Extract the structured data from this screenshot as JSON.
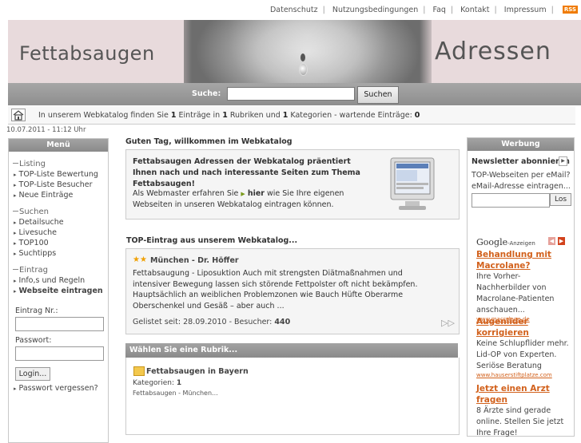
{
  "top_links": [
    "Datenschutz",
    "Nutzungsbedingungen",
    "Faq",
    "Kontakt",
    "Impressum"
  ],
  "rss_label": "RSS",
  "header": {
    "left_title": "Fettabsaugen",
    "right_title": "Adressen"
  },
  "search": {
    "label": "Suche:",
    "value": "",
    "button": "Suchen"
  },
  "infobar": {
    "t1": "In unserem Webkatalog finden Sie ",
    "eintraege": "1",
    "t2": " Einträge in ",
    "rubriken": "1",
    "t3": " Rubriken und ",
    "kategorien": "1",
    "t4": " Kategorien - wartende Einträge: ",
    "wartend": "0"
  },
  "datetime": "10.07.2011 - 11:12 Uhr",
  "menu": {
    "header": "Menü",
    "groups": [
      {
        "label": "Listing",
        "items": [
          "TOP-Liste Bewertung",
          "TOP-Liste Besucher",
          "Neue Einträge"
        ]
      },
      {
        "label": "Suchen",
        "items": [
          "Detailsuche",
          "Livesuche",
          "TOP100",
          "Suchtipps"
        ]
      },
      {
        "label": "Eintrag",
        "items": [
          "Info,s und Regeln",
          "Webseite eintragen"
        ]
      }
    ],
    "login": {
      "nr_label": "Eintrag Nr.:",
      "pw_label": "Passwort:",
      "button": "Login...",
      "forgot": "Passwort vergessen?"
    }
  },
  "main": {
    "greeting": "Guten Tag, willkommen im Webkatalog",
    "intro_bold": "Fettabsaugen Adressen der Webkatalog präentiert Ihnen nach und nach interessante Seiten zum Thema Fettabsaugen!",
    "intro_text_1": "Als Webmaster erfahren Sie ",
    "intro_link": "hier",
    "intro_text_2": " wie Sie Ihre eigenen Webseiten in unseren Webkatalog eintragen können.",
    "top_entry_heading": "TOP-Eintrag aus unserem Webkatalog...",
    "top_entry": {
      "stars": "★★",
      "title": "München - Dr. Höffer",
      "description": "Fettabsaugung - Liposuktion Auch mit strengsten Diätmaßnahmen und intensiver Bewegung lassen sich störende Fettpolster oft nicht bekämpfen. Hauptsächlich an weiblichen Problemzonen wie Bauch Hüfte Oberarme Oberschenkel und Gesäß – aber auch ...",
      "listed_label": "Gelistet seit: ",
      "listed_date": "28.09.2010",
      "visitors_label": " - Besucher: ",
      "visitors": "440"
    },
    "rubrik_heading": "Wählen Sie eine Rubrik...",
    "rubrik": {
      "name": "Fettabsaugen in Bayern",
      "cat_label": "Kategorien: ",
      "cat_count": "1",
      "sub": "Fettabsaugen - München..."
    }
  },
  "right": {
    "header": "Werbung",
    "newsletter_title": "Newsletter abonnieren",
    "newsletter_text": "TOP-Webseiten per eMail? eMail-Adresse eintragen...",
    "newsletter_button": "Los",
    "ads_label_brand": "Google",
    "ads_label_rest": "-Anzeigen",
    "ads": [
      {
        "title": "Behandlung mit Macrolane?",
        "desc": "Ihre Vorher-Nachherbilder von Macrolane-Patienten anschauen...",
        "url": "www.macrolane.de"
      },
      {
        "title": "Augenlider korrigieren",
        "desc": "Keine Schlupflider mehr. Lid-OP von Experten. Seriöse Beratung",
        "url": "www.hauserstiftplatze.com"
      },
      {
        "title": "Jetzt einen Arzt fragen",
        "desc": "8 Ärzte sind gerade online. Stellen Sie jetzt Ihre Frage!",
        "url": ""
      }
    ]
  },
  "colors": {
    "accent_orange": "#d2611c",
    "bar_gray": "#9a9a9a",
    "header_pink": "#e8dadc"
  }
}
